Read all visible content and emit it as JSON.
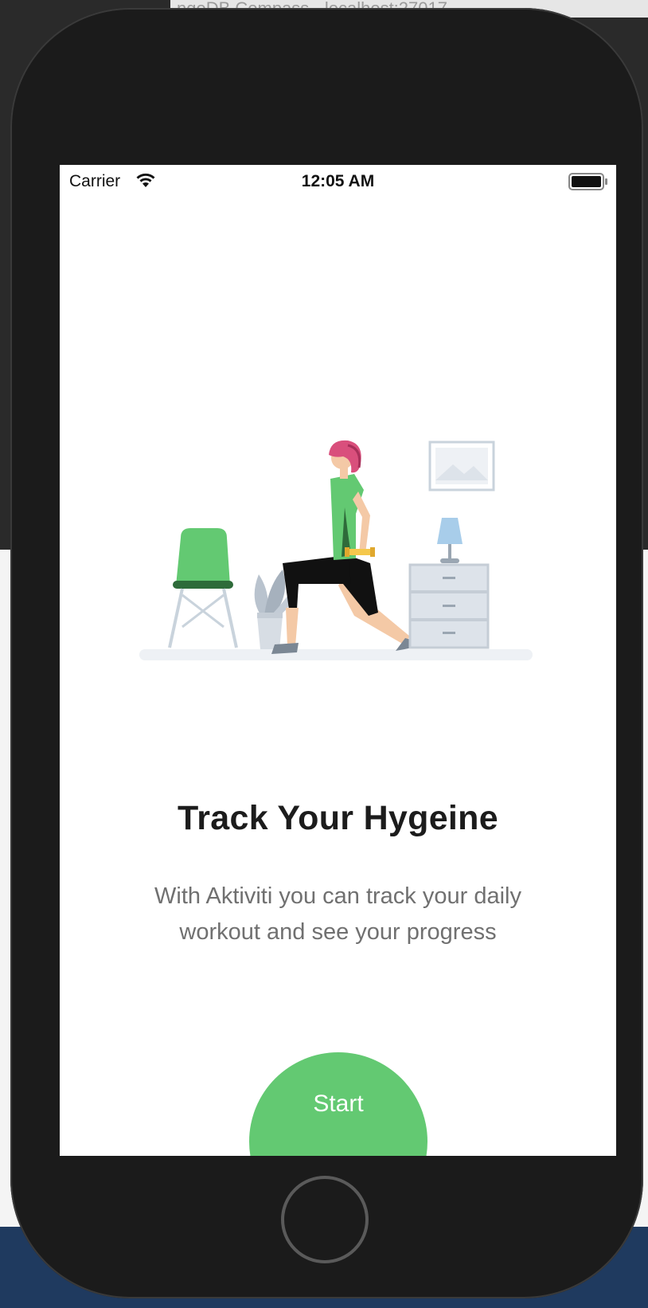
{
  "background": {
    "window_title": "ngoDB Compass - localhost:27017"
  },
  "status_bar": {
    "carrier": "Carrier",
    "time": "12:05 AM"
  },
  "onboarding": {
    "title": "Track Your Hygeine",
    "subtitle": "With Aktiviti you can track your daily workout and see your progress",
    "start_label": "Start"
  },
  "colors": {
    "accent": "#63c972",
    "dark_accent": "#2e6b3a",
    "phone_body": "#1b1b1b"
  },
  "icons": {
    "wifi": "wifi-icon",
    "battery": "battery-icon",
    "illustration": "workout-illustration"
  }
}
